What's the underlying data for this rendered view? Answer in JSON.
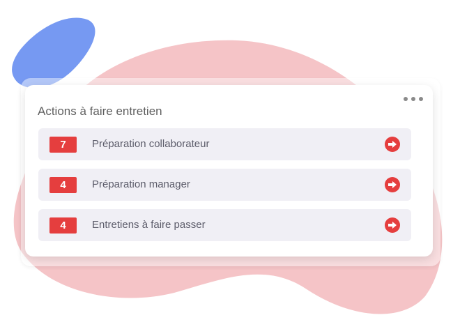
{
  "widget": {
    "title": "Actions à faire entretien",
    "menu_icon": "more-horizontal-icon",
    "items": [
      {
        "count": "7",
        "label": "Préparation collaborateur",
        "icon": "arrow-right-circle-icon"
      },
      {
        "count": "4",
        "label": "Préparation manager",
        "icon": "arrow-right-circle-icon"
      },
      {
        "count": "4",
        "label": "Entretiens à faire passer",
        "icon": "arrow-right-circle-icon"
      }
    ]
  },
  "colors": {
    "accent_red": "#e53e3e",
    "row_background": "#f0eff5",
    "blob_pink": "#f5c4c7",
    "blob_blue": "#7699f2"
  }
}
